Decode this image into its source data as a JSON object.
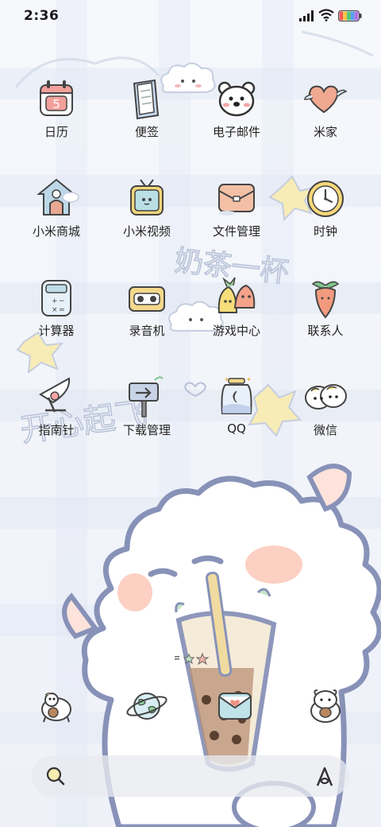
{
  "status_bar": {
    "time": "2:36",
    "battery_colors": [
      "#f05a5a",
      "#f5c342",
      "#55c47a",
      "#5aa0f0",
      "#b070e0"
    ]
  },
  "apps": [
    {
      "label": "日历",
      "icon": "calendar-icon",
      "date_number": "5"
    },
    {
      "label": "便签",
      "icon": "notes-icon"
    },
    {
      "label": "电子邮件",
      "icon": "email-icon"
    },
    {
      "label": "米家",
      "icon": "mijia-icon"
    },
    {
      "label": "小米商城",
      "icon": "mi-store-icon"
    },
    {
      "label": "小米视频",
      "icon": "mi-video-icon"
    },
    {
      "label": "文件管理",
      "icon": "file-manager-icon"
    },
    {
      "label": "时钟",
      "icon": "clock-icon"
    },
    {
      "label": "计算器",
      "icon": "calculator-icon"
    },
    {
      "label": "录音机",
      "icon": "recorder-icon"
    },
    {
      "label": "游戏中心",
      "icon": "game-center-icon"
    },
    {
      "label": "联系人",
      "icon": "contacts-icon"
    },
    {
      "label": "指南针",
      "icon": "compass-icon"
    },
    {
      "label": "下载管理",
      "icon": "download-manager-icon"
    },
    {
      "label": "QQ",
      "icon": "qq-icon"
    },
    {
      "label": "微信",
      "icon": "wechat-icon"
    }
  ],
  "dock": [
    {
      "icon": "phone-icon"
    },
    {
      "icon": "browser-icon"
    },
    {
      "icon": "messages-icon"
    },
    {
      "icon": "camera-icon"
    }
  ],
  "wallpaper_text": {
    "line1": "奶茶一杯",
    "line2": "开心起飞"
  },
  "search_bar": {
    "search_icon": "search-icon",
    "assistant_icon": "xiaoai-assistant-icon"
  }
}
